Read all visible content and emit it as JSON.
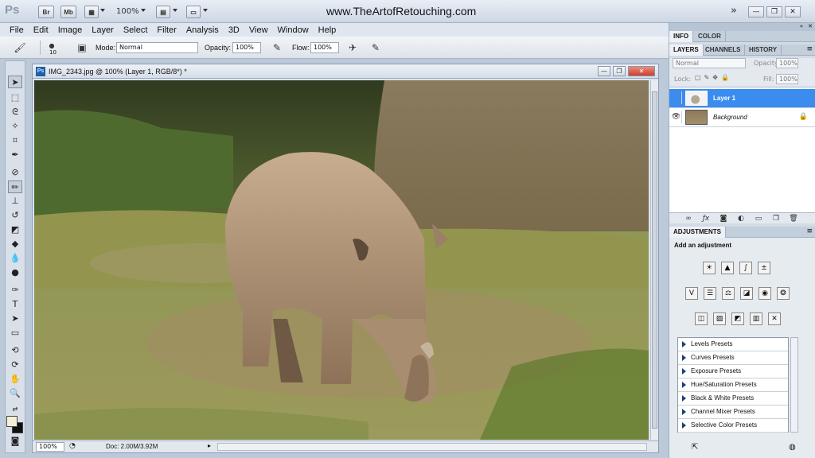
{
  "app": {
    "logo": "Ps",
    "site": "www.TheArtofRetouching.com"
  },
  "titlebar": {
    "btn_bridge": "Br",
    "btn_minibridge": "Mb",
    "zoom": "100%"
  },
  "menu": [
    "File",
    "Edit",
    "Image",
    "Layer",
    "Select",
    "Filter",
    "Analysis",
    "3D",
    "View",
    "Window",
    "Help"
  ],
  "options": {
    "brush_size": "10",
    "mode_label": "Mode:",
    "mode_value": "Normal",
    "opacity_label": "Opacity:",
    "opacity_value": "100%",
    "flow_label": "Flow:",
    "flow_value": "100%"
  },
  "document": {
    "title": "IMG_2343.jpg @ 100% (Layer 1, RGB/8*) *",
    "zoom": "100%",
    "doc_size": "Doc: 2.00M/3.92M",
    "close_glyph": "✕"
  },
  "panels": {
    "top_tabs": [
      "INFO",
      "COLOR"
    ],
    "layer_tabs": [
      "LAYERS",
      "CHANNELS",
      "HISTORY"
    ],
    "blend_mode": "Normal",
    "opacity_label": "Opacity:",
    "opacity_value": "100%",
    "lock_label": "Lock:",
    "fill_label": "Fill:",
    "fill_value": "100%",
    "layers": [
      {
        "name": "Layer 1",
        "selected": true
      },
      {
        "name": "Background",
        "selected": false,
        "locked": true
      }
    ],
    "adjustments_tab": "ADJUSTMENTS",
    "adjustments_title": "Add an adjustment",
    "presets": [
      "Levels Presets",
      "Curves Presets",
      "Exposure Presets",
      "Hue/Saturation Presets",
      "Black & White Presets",
      "Channel Mixer Presets",
      "Selective Color Presets"
    ]
  }
}
